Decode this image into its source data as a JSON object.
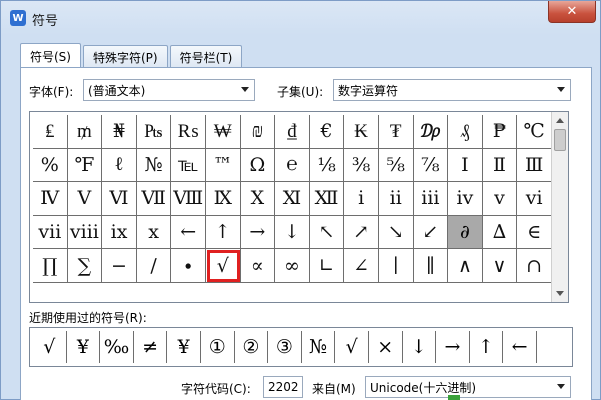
{
  "window": {
    "title": "符号",
    "close_label": "✕",
    "app_icon": "W"
  },
  "tabs": [
    {
      "label": "符号(S)",
      "active": true
    },
    {
      "label": "特殊字符(P)",
      "active": false
    },
    {
      "label": "符号栏(T)",
      "active": false
    }
  ],
  "font": {
    "label": "字体(F):",
    "value": "(普通文本)"
  },
  "subset": {
    "label": "子集(U):",
    "value": "数字运算符"
  },
  "symbols": [
    [
      "₤",
      "₥",
      "₦",
      "₧",
      "₨",
      "₩",
      "₪",
      "₫",
      "€",
      "₭",
      "₮",
      "₯",
      "₰",
      "₱",
      "℃"
    ],
    [
      "%",
      "℉",
      "ℓ",
      "№",
      "℡",
      "™",
      "Ω",
      "℮",
      "⅛",
      "⅜",
      "⅝",
      "⅞",
      "Ⅰ",
      "Ⅱ",
      "Ⅲ"
    ],
    [
      "Ⅳ",
      "Ⅴ",
      "Ⅵ",
      "Ⅶ",
      "Ⅷ",
      "Ⅸ",
      "Ⅹ",
      "Ⅺ",
      "Ⅻ",
      "ⅰ",
      "ⅱ",
      "ⅲ",
      "ⅳ",
      "ⅴ",
      "ⅵ"
    ],
    [
      "ⅶ",
      "ⅷ",
      "ⅸ",
      "ⅹ",
      "←",
      "↑",
      "→",
      "↓",
      "↖",
      "↗",
      "↘",
      "↙",
      "∂",
      "∆",
      "∈"
    ],
    [
      "∏",
      "∑",
      "−",
      "∕",
      "∙",
      "√",
      "∝",
      "∞",
      "∟",
      "∠",
      "∣",
      "∥",
      "∧",
      "∨",
      "∩"
    ]
  ],
  "recent": {
    "label": "近期使用过的符号(R):",
    "items": [
      "√",
      "¥",
      "‰",
      "≠",
      "¥",
      "①",
      "②",
      "③",
      "№",
      "√",
      "×",
      "↓",
      "→",
      "↑",
      "←"
    ]
  },
  "char_code": {
    "label": "字符代码(C):",
    "value": "2202",
    "from_label": "来自(M)",
    "from_value": "Unicode(十六进制)"
  }
}
